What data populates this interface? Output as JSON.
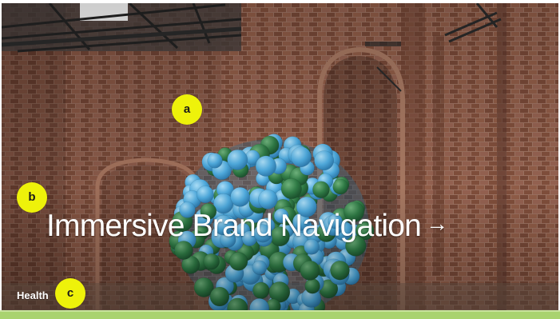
{
  "hero": {
    "headline": "Immersive Brand Navigation",
    "arrow_glyph": "→",
    "category_label": "Health"
  },
  "markers": [
    {
      "label": "a"
    },
    {
      "label": "b"
    },
    {
      "label": "c"
    }
  ],
  "colors": {
    "marker": "#eef20a",
    "bottom_bar": "#a9d36f",
    "headline_text": "#ffffff"
  }
}
